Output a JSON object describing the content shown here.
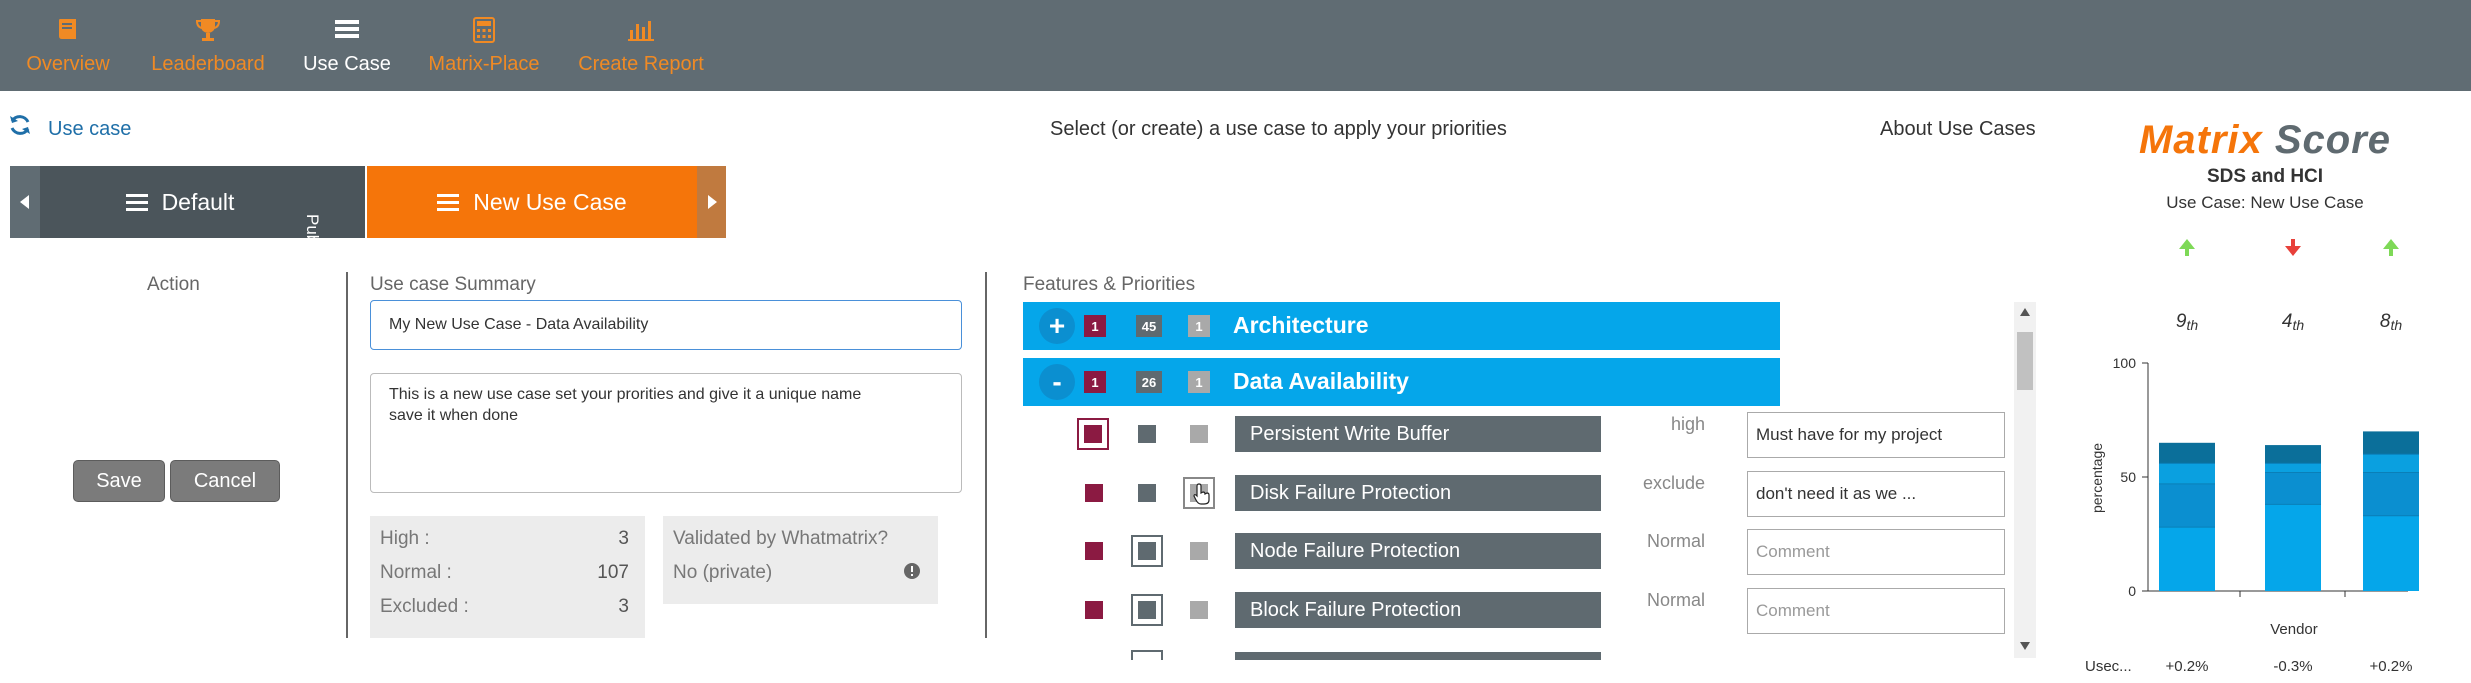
{
  "nav": {
    "items": [
      {
        "label": "Overview",
        "icon": "book-icon",
        "active": false
      },
      {
        "label": "Leaderboard",
        "icon": "trophy-icon",
        "active": false
      },
      {
        "label": "Use Case",
        "icon": "list-icon",
        "active": true
      },
      {
        "label": "Matrix-Place",
        "icon": "calculator-icon",
        "active": false
      },
      {
        "label": "Create Report",
        "icon": "bar-chart-icon",
        "active": false
      }
    ]
  },
  "header": {
    "use_case_link": "Use case",
    "instruction": "Select (or create) a use case to apply your priorities",
    "about_link": "About Use Cases"
  },
  "tabs": {
    "default_label": "Default",
    "default_side_label": "Public",
    "new_label": "New Use Case"
  },
  "action": {
    "heading": "Action",
    "save_label": "Save",
    "cancel_label": "Cancel"
  },
  "summary": {
    "heading": "Use case Summary",
    "name_value": "My New Use Case - Data Availability",
    "description_value": "This is a new use case set your prorities and give it a unique name\nsave it when done",
    "stats": [
      {
        "label": "High :",
        "value": "3"
      },
      {
        "label": "Normal :",
        "value": "107"
      },
      {
        "label": "Excluded :",
        "value": "3"
      }
    ],
    "validated_label": "Validated by Whatmatrix?",
    "validated_value": "No (private)"
  },
  "features": {
    "heading": "Features & Priorities",
    "categories": [
      {
        "toggle": "+",
        "high": "1",
        "normal": "45",
        "excluded": "1",
        "title": "Architecture"
      },
      {
        "toggle": "-",
        "high": "1",
        "normal": "26",
        "excluded": "1",
        "title": "Data Availability"
      }
    ],
    "rows": [
      {
        "name": "Persistent Write Buffer",
        "priority": "high",
        "comment": "Must have for my project",
        "placeholder": "Comment",
        "selected": "high"
      },
      {
        "name": "Disk Failure Protection",
        "priority": "exclude",
        "comment": "don't need it as we ...",
        "placeholder": "Comment",
        "selected": "exclude"
      },
      {
        "name": "Node Failure Protection",
        "priority": "Normal",
        "comment": "",
        "placeholder": "Comment",
        "selected": "normal"
      },
      {
        "name": "Block Failure Protection",
        "priority": "Normal",
        "comment": "",
        "placeholder": "Comment",
        "selected": "normal"
      }
    ]
  },
  "score": {
    "logo_word1": "Matrix",
    "logo_word2": "Score",
    "subtitle": "SDS and HCI",
    "use_case_line": "Use Case: New Use Case",
    "vendors": [
      {
        "trend": "up",
        "rank": "9",
        "suffix": "th",
        "delta": "+0.2%"
      },
      {
        "trend": "down",
        "rank": "4",
        "suffix": "th",
        "delta": "-0.3%"
      },
      {
        "trend": "up",
        "rank": "8",
        "suffix": "th",
        "delta": "+0.2%"
      }
    ],
    "row_label": "Usec...",
    "colors": {
      "up": "#7ed957",
      "down": "#e8403a"
    }
  },
  "chart_data": {
    "type": "bar",
    "stacked": true,
    "categories": [
      "",
      "",
      ""
    ],
    "series": [
      {
        "values": [
          28,
          38,
          33
        ],
        "color": "#05a6ea"
      },
      {
        "values": [
          19,
          14,
          19
        ],
        "color": "#0b8fd0"
      },
      {
        "values": [
          9,
          4,
          8
        ],
        "color": "#0aa0e0"
      },
      {
        "values": [
          9,
          8,
          10
        ],
        "color": "#0b6f9a"
      }
    ],
    "xlabel": "Vendor",
    "ylabel": "percentage",
    "ylim": [
      0,
      100
    ],
    "yticks": [
      "0",
      "50",
      "100"
    ]
  }
}
